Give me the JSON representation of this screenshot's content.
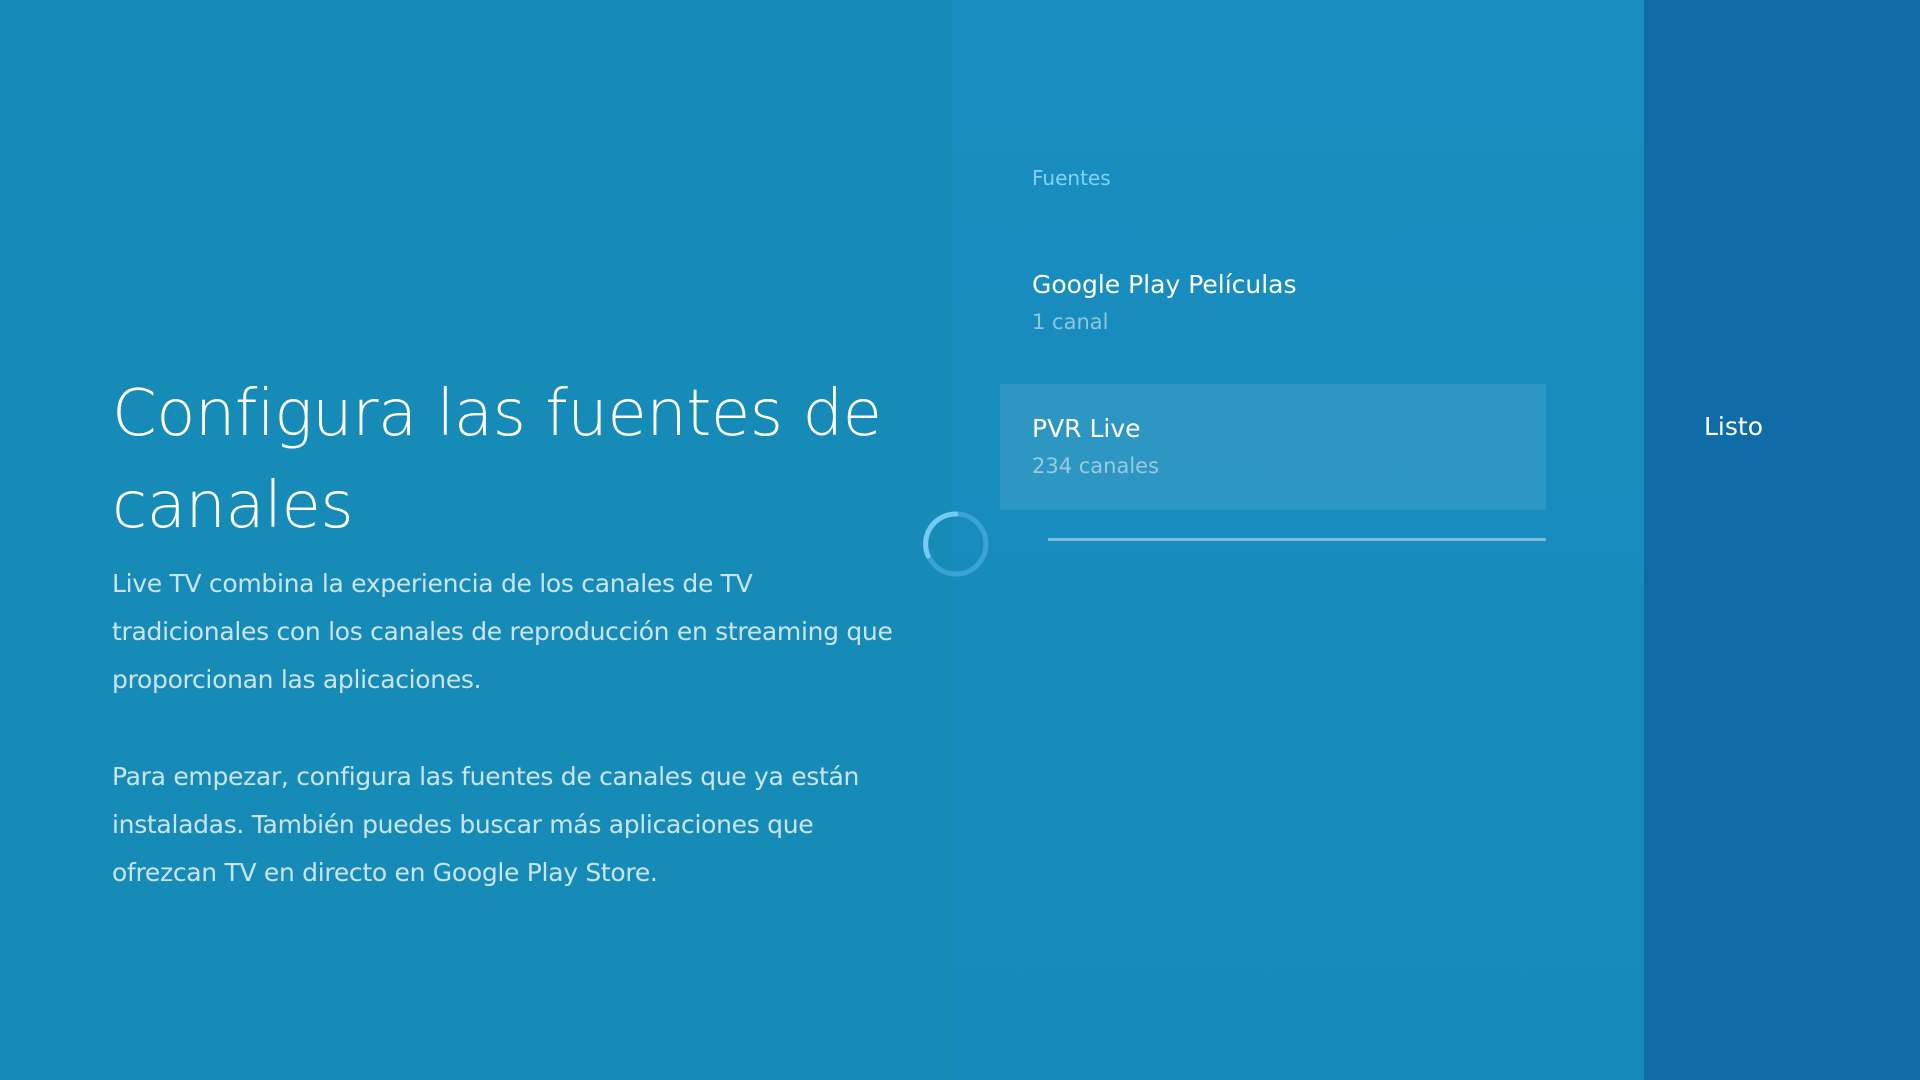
{
  "description_panel": {
    "title": "Configura las fuentes de canales",
    "paragraph_1": "Live TV combina la experiencia de los canales de TV tradicionales con los canales de reproducción en streaming que proporcionan las aplicaciones.",
    "paragraph_2": "Para empezar, configura las fuentes de canales que ya están instaladas. También puedes buscar más aplicaciones que ofrezcan TV en directo en Google Play Store."
  },
  "sources": {
    "header": "Fuentes",
    "items": [
      {
        "title": "Google Play Películas",
        "subtitle": "1 canal"
      },
      {
        "title": "PVR Live",
        "subtitle": "234 canales"
      }
    ]
  },
  "actions": {
    "done_label": "Listo"
  },
  "colors": {
    "background": "#168bb8",
    "action_panel": "#0f6ca6",
    "section_label": "#7fd4ff"
  },
  "icons": {
    "loading": "loading-spinner-icon"
  }
}
